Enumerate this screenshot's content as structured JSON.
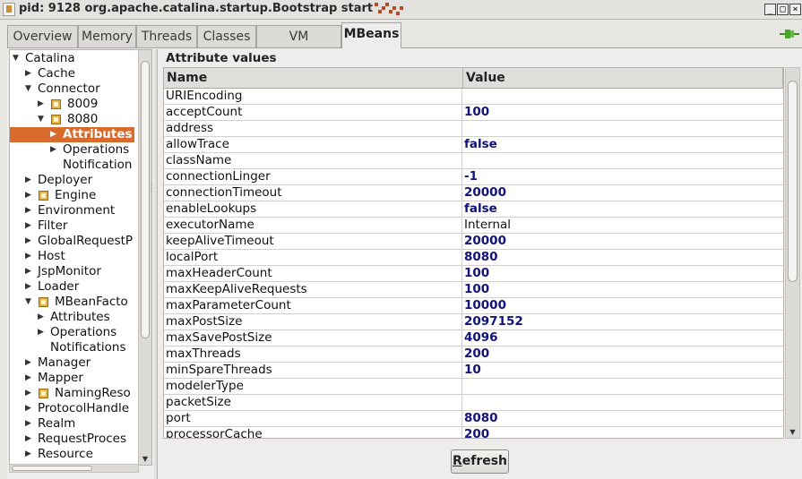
{
  "window": {
    "title": "pid: 9128 org.apache.catalina.startup.Bootstrap start",
    "minimize_glyph": "_",
    "maximize_glyph": "□",
    "close_glyph": "×"
  },
  "tabs": [
    {
      "label": "Overview",
      "active": false
    },
    {
      "label": "Memory",
      "active": false
    },
    {
      "label": "Threads",
      "active": false
    },
    {
      "label": "Classes",
      "active": false
    },
    {
      "label": "VM Summary",
      "active": false
    },
    {
      "label": "MBeans",
      "active": true
    }
  ],
  "tree": {
    "items": [
      {
        "label": "Catalina",
        "expanded": true
      },
      {
        "label": "Cache"
      },
      {
        "label": "Connector",
        "expanded": true
      },
      {
        "label": "8009",
        "icon": "bean-icon"
      },
      {
        "label": "8080",
        "icon": "bean-icon",
        "expanded": true
      },
      {
        "label": "Attributes",
        "selected": true
      },
      {
        "label": "Operations"
      },
      {
        "label": "Notification"
      },
      {
        "label": "Deployer"
      },
      {
        "label": "Engine",
        "icon": "bean-icon"
      },
      {
        "label": "Environment"
      },
      {
        "label": "Filter"
      },
      {
        "label": "GlobalRequestP"
      },
      {
        "label": "Host"
      },
      {
        "label": "JspMonitor"
      },
      {
        "label": "Loader"
      },
      {
        "label": "MBeanFacto",
        "icon": "bean-icon",
        "expanded": true
      },
      {
        "label": "Attributes"
      },
      {
        "label": "Operations"
      },
      {
        "label": "Notifications"
      },
      {
        "label": "Manager"
      },
      {
        "label": "Mapper"
      },
      {
        "label": "NamingReso",
        "icon": "bean-icon"
      },
      {
        "label": "ProtocolHandle"
      },
      {
        "label": "Realm"
      },
      {
        "label": "RequestProces"
      },
      {
        "label": "Resource"
      }
    ]
  },
  "attributes": {
    "section_title": "Attribute values",
    "col_name": "Name",
    "col_value": "Value",
    "rows": [
      {
        "name": "URIEncoding",
        "value": ""
      },
      {
        "name": "acceptCount",
        "value": "100"
      },
      {
        "name": "address",
        "value": ""
      },
      {
        "name": "allowTrace",
        "value": "false"
      },
      {
        "name": "className",
        "value": ""
      },
      {
        "name": "connectionLinger",
        "value": "-1"
      },
      {
        "name": "connectionTimeout",
        "value": "20000"
      },
      {
        "name": "enableLookups",
        "value": "false"
      },
      {
        "name": "executorName",
        "value": "Internal",
        "plain": true
      },
      {
        "name": "keepAliveTimeout",
        "value": "20000"
      },
      {
        "name": "localPort",
        "value": "8080"
      },
      {
        "name": "maxHeaderCount",
        "value": "100"
      },
      {
        "name": "maxKeepAliveRequests",
        "value": "100"
      },
      {
        "name": "maxParameterCount",
        "value": "10000"
      },
      {
        "name": "maxPostSize",
        "value": "2097152"
      },
      {
        "name": "maxSavePostSize",
        "value": "4096"
      },
      {
        "name": "maxThreads",
        "value": "200"
      },
      {
        "name": "minSpareThreads",
        "value": "10"
      },
      {
        "name": "modelerType",
        "value": ""
      },
      {
        "name": "packetSize",
        "value": ""
      },
      {
        "name": "port",
        "value": "8080"
      },
      {
        "name": "processorCache",
        "value": "200"
      }
    ]
  },
  "refresh_button": {
    "label": "Refresh",
    "mnemonic": "R"
  },
  "colors": {
    "selection": "#d86b2c",
    "value_text": "#12127a",
    "connection_icon": "#4aa52e"
  }
}
